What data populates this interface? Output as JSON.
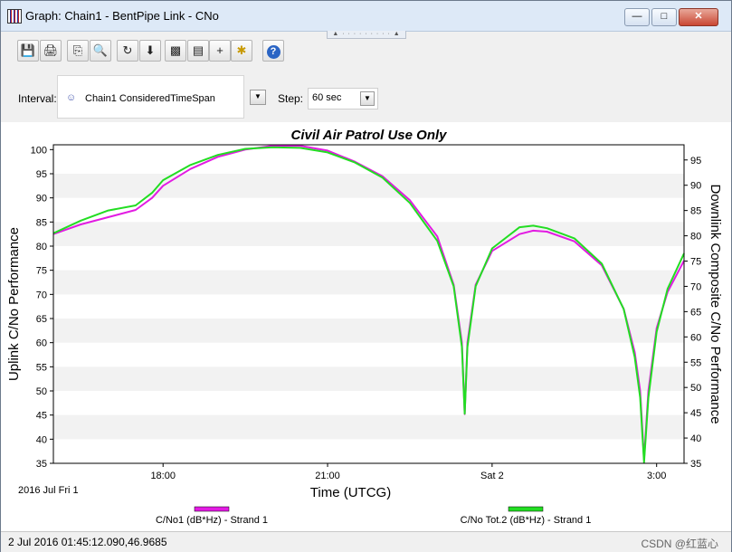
{
  "window": {
    "title": "Graph:  Chain1 - BentPipe Link - CNo",
    "minimize_icon": "minimize-icon",
    "maximize_icon": "maximize-icon",
    "close_icon": "close-icon"
  },
  "toolbar": {
    "icons": [
      "save-icon",
      "print-icon",
      "copy-icon",
      "zoom-icon",
      "refresh-icon",
      "export-icon",
      "graph-properties-icon",
      "report-icon",
      "crosshair-icon",
      "animate-icon",
      "help-icon"
    ],
    "glyphs": [
      "💾",
      "🖨",
      "⎘",
      "🔍",
      "↻",
      "⬇",
      "▩",
      "▤",
      "+",
      "✱",
      "?"
    ]
  },
  "interval": {
    "label": "Interval:",
    "value": "Chain1 ConsideredTimeSpan",
    "dropdown_icon": "chevron-down-icon"
  },
  "step": {
    "label": "Step:",
    "value": "60 sec",
    "icon": "step-selector-icon"
  },
  "status": {
    "text": "2 Jul 2016 01:45:12.090,46.9685",
    "watermark": "CSDN @红蓝心"
  },
  "chart_data": {
    "type": "line",
    "title": "Civil Air Patrol Use Only",
    "xlabel": "Time (UTCG)",
    "ylabel_left": "Uplink C/No Performance",
    "ylabel_right": "Downlink Composite C/No Performance",
    "x_unit": "hours since 2016 Jul 1 00:00 UTCG",
    "xlim": [
      16.0,
      27.5
    ],
    "x_ticks": [
      {
        "x": 18.0,
        "label": "18:00"
      },
      {
        "x": 21.0,
        "label": "21:00"
      },
      {
        "x": 24.0,
        "label": "Sat 2"
      },
      {
        "x": 27.0,
        "label": "3:00"
      }
    ],
    "x_start_label": "2016 Jul Fri 1",
    "ylim_left": [
      35,
      101
    ],
    "y_ticks_left": [
      35,
      40,
      45,
      50,
      55,
      60,
      65,
      70,
      75,
      80,
      85,
      90,
      95,
      100
    ],
    "ylim_right": [
      35,
      98
    ],
    "y_ticks_right": [
      35,
      40,
      45,
      50,
      55,
      60,
      65,
      70,
      75,
      80,
      85,
      90,
      95
    ],
    "grid": "horizontal bands",
    "legend_position": "bottom",
    "series": [
      {
        "name": "C/No1 (dB*Hz) - Strand 1",
        "color": "#e21be2",
        "axis": "left",
        "points": [
          [
            16.0,
            82.5
          ],
          [
            16.5,
            84.5
          ],
          [
            17.0,
            86.0
          ],
          [
            17.5,
            87.5
          ],
          [
            17.8,
            90.0
          ],
          [
            18.0,
            92.5
          ],
          [
            18.5,
            96.0
          ],
          [
            19.0,
            98.5
          ],
          [
            19.5,
            100.0
          ],
          [
            20.0,
            100.8
          ],
          [
            20.5,
            100.8
          ],
          [
            21.0,
            99.8
          ],
          [
            21.5,
            97.5
          ],
          [
            22.0,
            94.5
          ],
          [
            22.5,
            89.5
          ],
          [
            23.0,
            82.0
          ],
          [
            23.3,
            72.0
          ],
          [
            23.45,
            60.0
          ],
          [
            23.5,
            45.2
          ],
          [
            23.55,
            60.0
          ],
          [
            23.7,
            72.0
          ],
          [
            24.0,
            79.0
          ],
          [
            24.5,
            82.5
          ],
          [
            24.75,
            83.2
          ],
          [
            25.0,
            83.0
          ],
          [
            25.5,
            81.0
          ],
          [
            26.0,
            76.0
          ],
          [
            26.4,
            67.0
          ],
          [
            26.6,
            58.0
          ],
          [
            26.7,
            50.0
          ],
          [
            26.77,
            35.8
          ],
          [
            26.85,
            50.0
          ],
          [
            27.0,
            63.0
          ],
          [
            27.2,
            70.5
          ],
          [
            27.5,
            77.0
          ]
        ]
      },
      {
        "name": "C/No Tot.2 (dB*Hz) - Strand 1",
        "color": "#22dd22",
        "axis": "right",
        "points": [
          [
            16.0,
            80.5
          ],
          [
            16.5,
            83.0
          ],
          [
            17.0,
            85.0
          ],
          [
            17.5,
            86.0
          ],
          [
            17.8,
            88.5
          ],
          [
            18.0,
            91.0
          ],
          [
            18.5,
            94.0
          ],
          [
            19.0,
            96.0
          ],
          [
            19.5,
            97.2
          ],
          [
            20.0,
            97.5
          ],
          [
            20.5,
            97.4
          ],
          [
            21.0,
            96.5
          ],
          [
            21.5,
            94.5
          ],
          [
            22.0,
            91.5
          ],
          [
            22.5,
            86.5
          ],
          [
            23.0,
            79.0
          ],
          [
            23.3,
            70.0
          ],
          [
            23.45,
            58.0
          ],
          [
            23.5,
            44.8
          ],
          [
            23.55,
            58.0
          ],
          [
            23.7,
            70.0
          ],
          [
            24.0,
            77.5
          ],
          [
            24.5,
            81.7
          ],
          [
            24.75,
            82.0
          ],
          [
            25.0,
            81.5
          ],
          [
            25.5,
            79.5
          ],
          [
            26.0,
            74.5
          ],
          [
            26.4,
            65.5
          ],
          [
            26.6,
            56.0
          ],
          [
            26.7,
            48.0
          ],
          [
            26.77,
            35.2
          ],
          [
            26.85,
            48.0
          ],
          [
            27.0,
            61.0
          ],
          [
            27.2,
            69.5
          ],
          [
            27.5,
            76.5
          ]
        ]
      }
    ]
  }
}
